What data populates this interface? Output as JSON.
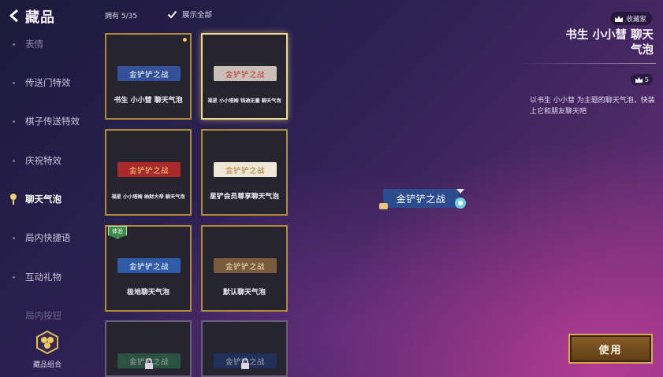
{
  "header": {
    "title": "藏品",
    "owned": "拥有 5/35",
    "show_all": "展示全部"
  },
  "sidebar": {
    "items": [
      {
        "label": "表情",
        "state": "dim"
      },
      {
        "label": "传送门特效",
        "state": "normal"
      },
      {
        "label": "棋子传送特效",
        "state": "normal"
      },
      {
        "label": "庆祝特效",
        "state": "normal"
      },
      {
        "label": "聊天气泡",
        "state": "active"
      },
      {
        "label": "局内快捷语",
        "state": "normal"
      },
      {
        "label": "互动礼物",
        "state": "normal"
      },
      {
        "label": "局内按钮",
        "state": "faded"
      }
    ],
    "combo_label": "藏品组合"
  },
  "grid": {
    "cards": [
      {
        "bubble": "金铲铲之战",
        "name": "书生  小小彗  聊天气泡",
        "bubble_color": "#33509a",
        "selected": false,
        "new_dot": true,
        "trial": false,
        "locked": false,
        "small": false
      },
      {
        "bubble": "金铲铲之战",
        "name": "福星  小小塔姆  钱途无量  聊天气泡",
        "bubble_color": "#c9bfb8",
        "text_color": "#c0392b",
        "selected": true,
        "new_dot": false,
        "trial": false,
        "locked": false,
        "small": true
      },
      {
        "bubble": "金铲铲之战",
        "name": "福星  小小塔姆  纳财大帝  聊天气泡",
        "bubble_color": "#a82a2a",
        "text_color": "#f3d27a",
        "selected": false,
        "new_dot": false,
        "trial": false,
        "locked": false,
        "small": true
      },
      {
        "bubble": "金铲铲之战",
        "name": "星铲会员尊享聊天气泡",
        "bubble_color": "#efe7d6",
        "text_color": "#b07a28",
        "selected": false,
        "new_dot": false,
        "trial": false,
        "locked": false,
        "small": false
      },
      {
        "bubble": "金铲铲之战",
        "name": "极地聊天气泡",
        "bubble_color": "#2e5aa8",
        "selected": false,
        "new_dot": false,
        "trial": true,
        "locked": false,
        "small": false
      },
      {
        "bubble": "金铲铲之战",
        "name": "默认聊天气泡",
        "bubble_color": "#7a5b3c",
        "selected": false,
        "new_dot": false,
        "trial": false,
        "locked": false,
        "small": false
      },
      {
        "bubble": "金铲铲之战",
        "name": "",
        "bubble_color": "#2f7a52",
        "selected": false,
        "new_dot": false,
        "trial": false,
        "locked": true,
        "small": false
      },
      {
        "bubble": "金铲铲之战",
        "name": "",
        "bubble_color": "#1c3a7a",
        "selected": false,
        "new_dot": false,
        "trial": false,
        "locked": true,
        "small": false
      }
    ],
    "trial_badge": "体验"
  },
  "preview": {
    "bubble": "金铲铲之战"
  },
  "detail": {
    "collector_badge": "收藏家",
    "title_line1": "书生  小小彗  聊天",
    "title_line2": "气泡",
    "points": "5",
    "description": "以书生 小小彗 为主题的聊天气泡，快装上它和朋友聊天吧",
    "use_button": "使用"
  },
  "colors": {
    "accent_gold": "#b08a3c",
    "selected_gold": "#f0d78a",
    "new_dot": "#f4c33a"
  }
}
